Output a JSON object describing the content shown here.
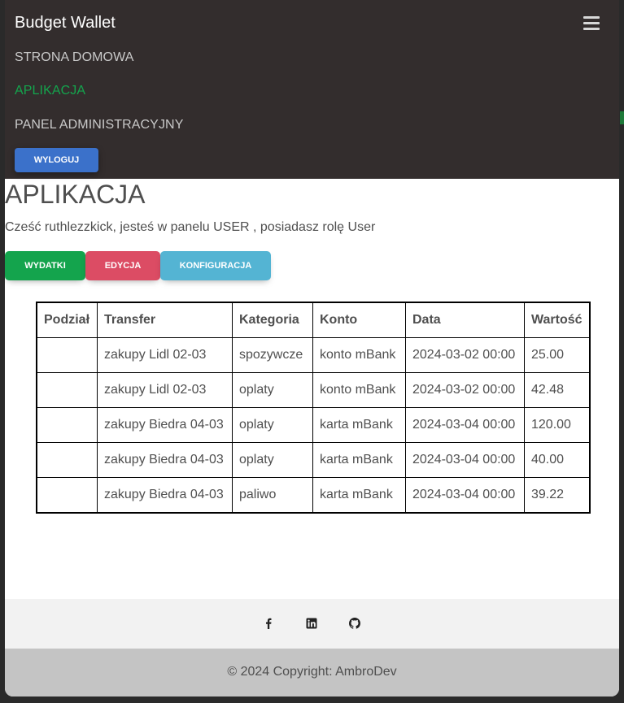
{
  "navbar": {
    "brand": "Budget Wallet",
    "links": [
      "STRONA DOMOWA",
      "APLIKACJA",
      "PANEL ADMINISTRACYJNY"
    ],
    "logout_label": "WYLOGUJ"
  },
  "main": {
    "title": "APLIKACJA",
    "greeting": "Cześć ruthlezzkick, jesteś w panelu USER , posiadasz rolę User",
    "tabs": [
      "WYDATKI",
      "EDYCJA",
      "KONFIGURACJA"
    ]
  },
  "table": {
    "headers": [
      "Podział",
      "Transfer",
      "Kategoria",
      "Konto",
      "Data",
      "Wartość"
    ],
    "rows": [
      [
        "",
        "zakupy Lidl 02-03",
        "spozywcze",
        "konto mBank",
        "2024-03-02 00:00",
        "25.00"
      ],
      [
        "",
        "zakupy Lidl 02-03",
        "oplaty",
        "konto mBank",
        "2024-03-02 00:00",
        "42.48"
      ],
      [
        "",
        "zakupy Biedra 04-03",
        "oplaty",
        "karta mBank",
        "2024-03-04 00:00",
        "120.00"
      ],
      [
        "",
        "zakupy Biedra 04-03",
        "oplaty",
        "karta mBank",
        "2024-03-04 00:00",
        "40.00"
      ],
      [
        "",
        "zakupy Biedra 04-03",
        "paliwo",
        "karta mBank",
        "2024-03-04 00:00",
        "39.22"
      ]
    ]
  },
  "footer": {
    "social_icons": [
      "facebook-icon",
      "linkedin-icon",
      "github-icon"
    ],
    "copyright": "© 2024 Copyright: AmbroDev"
  },
  "colors": {
    "navbar_bg": "#332d2d",
    "active_link": "#14a44d",
    "primary": "#3b71ca",
    "success": "#14a44d",
    "danger": "#dc4c64",
    "info": "#54b4d3"
  }
}
